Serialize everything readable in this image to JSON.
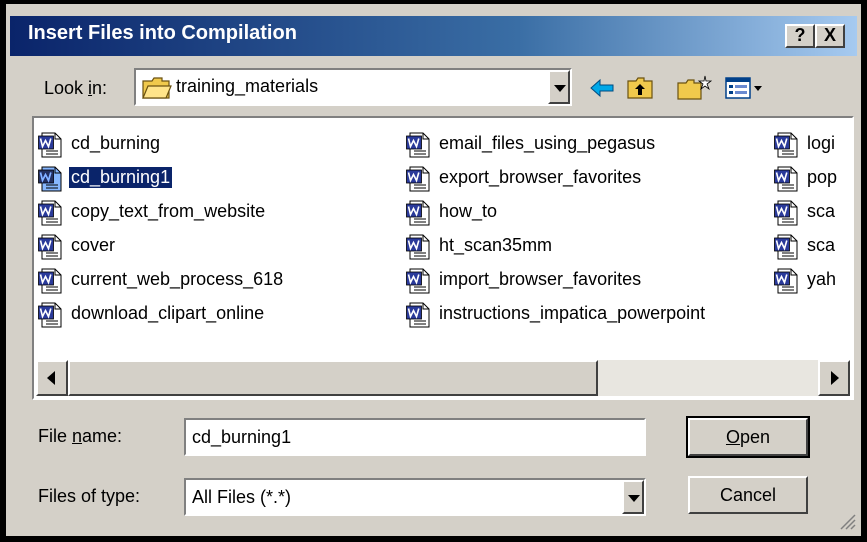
{
  "dialog": {
    "title": "Insert Files into Compilation",
    "help_label": "?",
    "close_label": "X"
  },
  "look_in": {
    "label_pre": "Look ",
    "label_key": "i",
    "label_post": "n:",
    "value": "training_materials"
  },
  "files": [
    {
      "name": "cd_burning",
      "selected": false
    },
    {
      "name": "cd_burning1",
      "selected": true
    },
    {
      "name": "copy_text_from_website",
      "selected": false
    },
    {
      "name": "cover",
      "selected": false
    },
    {
      "name": "current_web_process_618",
      "selected": false
    },
    {
      "name": "download_clipart_online",
      "selected": false
    },
    {
      "name": "email_files_using_pegasus",
      "selected": false
    },
    {
      "name": "export_browser_favorites",
      "selected": false
    },
    {
      "name": "how_to",
      "selected": false
    },
    {
      "name": "ht_scan35mm",
      "selected": false
    },
    {
      "name": "import_browser_favorites",
      "selected": false
    },
    {
      "name": "instructions_impatica_powerpoint",
      "selected": false
    },
    {
      "name": "logi",
      "selected": false
    },
    {
      "name": "pop",
      "selected": false
    },
    {
      "name": "sca",
      "selected": false
    },
    {
      "name": "sca",
      "selected": false
    },
    {
      "name": "yah",
      "selected": false
    }
  ],
  "file_name": {
    "label_pre": "File ",
    "label_key": "n",
    "label_post": "ame:",
    "value": "cd_burning1"
  },
  "file_type": {
    "label": "Files of type:",
    "value": "All Files (*.*)"
  },
  "buttons": {
    "open_key": "O",
    "open_rest": "pen",
    "cancel": "Cancel"
  },
  "colors": {
    "title_start": "#0a246a",
    "title_end": "#a6caf0",
    "face": "#d4d0c8",
    "selection": "#0a246a",
    "word_icon": "#2a3a9a"
  },
  "icons": [
    "folder-icon",
    "back-arrow-icon",
    "up-folder-icon",
    "new-folder-icon",
    "view-menu-icon",
    "word-document-icon"
  ]
}
